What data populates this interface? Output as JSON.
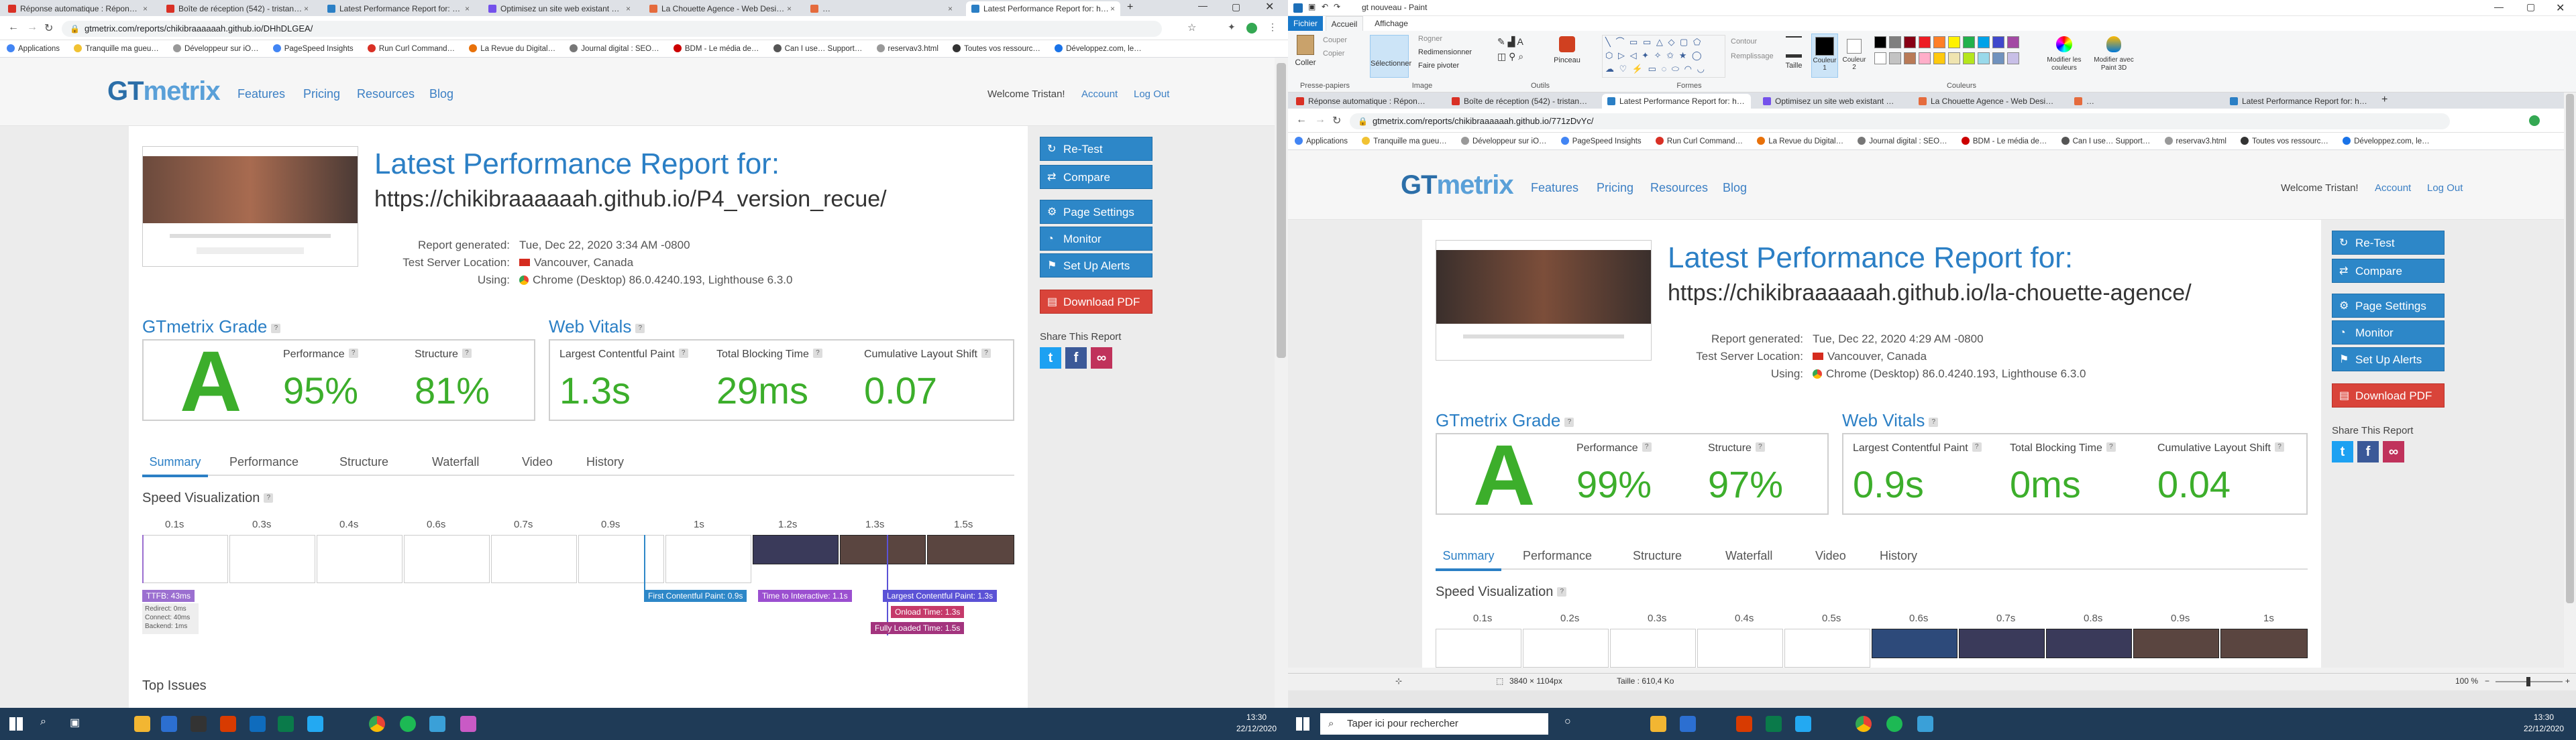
{
  "left": {
    "tabs": [
      "Réponse automatique : Répon…",
      "Boîte de réception (542) - tristan…",
      "Latest Performance Report for: …",
      "Optimisez un site web existant …",
      "La Chouette Agence - Web Desi…",
      "…",
      "Latest Performance Report for: h…"
    ],
    "address": "gtmetrix.com/reports/chikibraaaaaah.github.io/DHhDLGEA/",
    "bookmarks": [
      "Applications",
      "Tranquille ma gueu…",
      "Développeur sur iO…",
      "PageSpeed Insights",
      "Run Curl Command…",
      "La Revue du Digital…",
      "Journal digital : SEO…",
      "BDM - Le média de…",
      "Can I use… Support…",
      "reservav3.html",
      "Toutes vos ressourc…",
      "Développez.com, le…"
    ],
    "report": {
      "title": "Latest Performance Report for:",
      "url": "https://chikibraaaaaah.github.io/P4_version_recue/",
      "generated_label": "Report generated:",
      "generated": "Tue, Dec 22, 2020 3:34 AM -0800",
      "server_label": "Test Server Location:",
      "server": "Vancouver, Canada",
      "using_label": "Using:",
      "using": "Chrome (Desktop) 86.0.4240.193, Lighthouse 6.3.0",
      "grade": "A",
      "performance": "95%",
      "structure": "81%",
      "lcp": "1.3s",
      "tbt": "29ms",
      "cls": "0.07"
    },
    "ticks": [
      "0.1s",
      "0.3s",
      "0.4s",
      "0.6s",
      "0.7s",
      "0.9s",
      "1s",
      "1.2s",
      "1.3s",
      "1.5s"
    ],
    "ttfb": "TTFB: 43ms",
    "ttfb_details": [
      "Redirect: 0ms",
      "Connect: 40ms",
      "Backend: 1ms"
    ],
    "markers": [
      "First Contentful Paint: 0.9s",
      "Time to Interactive: 1.1s",
      "Largest Contentful Paint: 1.3s",
      "Onload Time: 1.3s",
      "Fully Loaded Time: 1.5s"
    ],
    "top_issues": "Top Issues"
  },
  "right": {
    "tabs": [
      "Réponse automatique : Répon…",
      "Boîte de réception (542) - tristan…",
      "Latest Performance Report for: h…",
      "Optimisez un site web existant …",
      "La Chouette Agence - Web Desi…",
      "…",
      "Latest Performance Report for: h…"
    ],
    "address": "gtmetrix.com/reports/chikibraaaaaah.github.io/771zDvYc/",
    "bookmarks": [
      "Applications",
      "Tranquille ma gueu…",
      "Développeur sur iO…",
      "PageSpeed Insights",
      "Run Curl Command…",
      "La Revue du Digital…",
      "Journal digital : SEO…",
      "BDM - Le média de…",
      "Can I use… Support…",
      "reservav3.html",
      "Toutes vos ressourc…",
      "Développez.com, le…"
    ],
    "report": {
      "title": "Latest Performance Report for:",
      "url": "https://chikibraaaaaah.github.io/la-chouette-agence/",
      "generated_label": "Report generated:",
      "generated": "Tue, Dec 22, 2020 4:29 AM -0800",
      "server_label": "Test Server Location:",
      "server": "Vancouver, Canada",
      "using_label": "Using:",
      "using": "Chrome (Desktop) 86.0.4240.193, Lighthouse 6.3.0",
      "grade": "A",
      "performance": "99%",
      "structure": "97%",
      "lcp": "0.9s",
      "tbt": "0ms",
      "cls": "0.04"
    },
    "ticks": [
      "0.1s",
      "0.2s",
      "0.3s",
      "0.4s",
      "0.5s",
      "0.6s",
      "0.7s",
      "0.8s",
      "0.9s",
      "1s"
    ]
  },
  "gt": {
    "nav": [
      "Features",
      "Pricing",
      "Resources",
      "Blog"
    ],
    "welcome": "Welcome Tristan!",
    "account": "Account",
    "logout": "Log Out",
    "buttons": [
      "Re-Test",
      "Compare",
      "Page Settings",
      "Monitor",
      "Set Up Alerts",
      "Download PDF"
    ],
    "share": "Share This Report",
    "grade_section": "GTmetrix Grade",
    "vitals_section": "Web Vitals",
    "performance_label": "Performance",
    "structure_label": "Structure",
    "lcp_label": "Largest Contentful Paint",
    "tbt_label": "Total Blocking Time",
    "cls_label": "Cumulative Layout Shift",
    "tabs": [
      "Summary",
      "Performance",
      "Structure",
      "Waterfall",
      "Video",
      "History"
    ],
    "speed_vis": "Speed Visualization"
  },
  "paint": {
    "title": "gt nouveau - Paint",
    "menu": [
      "Fichier",
      "Accueil",
      "Affichage"
    ],
    "clipboard": [
      "Coller",
      "Couper",
      "Copier"
    ],
    "image": [
      "Sélectionner",
      "Rogner",
      "Redimensionner",
      "Faire pivoter"
    ],
    "groups": [
      "Presse-papiers",
      "Image",
      "Outils",
      "Formes",
      "Couleurs"
    ],
    "shape_opts": [
      "Contour",
      "Remplissage"
    ],
    "size": "Taille",
    "color1": "Couleur 1",
    "color2": "Couleur 2",
    "edit_colors": "Modifier les couleurs",
    "paint3d": "Modifier avec Paint 3D",
    "pencil": "Pinceau",
    "status_dims": "3840 × 1104px",
    "status_size": "Taille : 610,4 Ko",
    "zoom": "100 %",
    "palette": [
      "#000000",
      "#7f7f7f",
      "#880015",
      "#ed1c24",
      "#ff7f27",
      "#fff200",
      "#22b14c",
      "#00a2e8",
      "#3f48cc",
      "#a349a4",
      "#ffffff",
      "#c3c3c3",
      "#b97a57",
      "#ffaec9",
      "#ffc90e",
      "#efe4b0",
      "#b5e61d",
      "#99d9ea",
      "#7092be",
      "#c8bfe7"
    ]
  },
  "taskbar": {
    "search": "Taper ici pour rechercher",
    "time": "13:30",
    "date": "22/12/2020"
  },
  "colors": {
    "brand": "#2b7fc5",
    "grade_green": "#3cae2b",
    "button_blue": "#2d87c8",
    "button_red": "#d9443a",
    "taskbar": "#1f3b57"
  }
}
